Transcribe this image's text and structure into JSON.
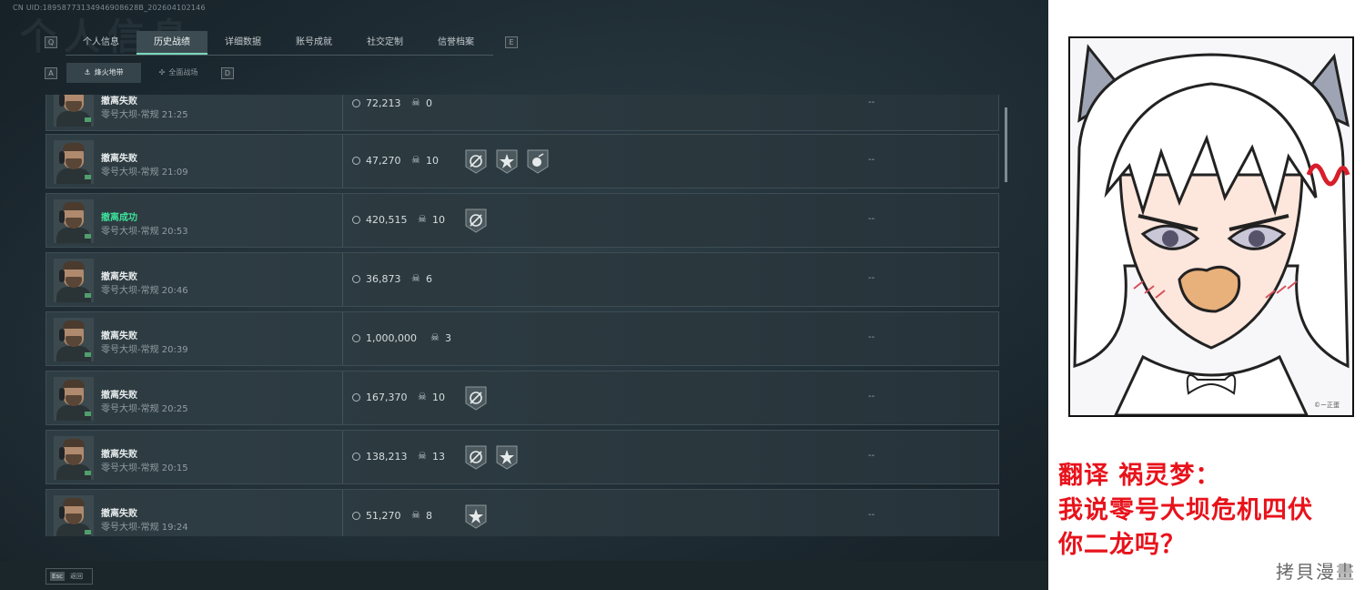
{
  "game": {
    "uid_text": "CN UID:18958773134946908628B_202604102146",
    "bg_title": "个人信息",
    "key_left": "Q",
    "key_right": "E",
    "sub_key_left": "A",
    "sub_key_right": "D",
    "tabs": [
      {
        "label": "个人信息",
        "active": false
      },
      {
        "label": "历史战绩",
        "active": true
      },
      {
        "label": "详细数据",
        "active": false
      },
      {
        "label": "账号成就",
        "active": false
      },
      {
        "label": "社交定制",
        "active": false
      },
      {
        "label": "信誉档案",
        "active": false
      }
    ],
    "subtabs": [
      {
        "label": "烽火地带",
        "icon": "lighthouse-icon",
        "active": true
      },
      {
        "label": "全面战场",
        "icon": "crosshair-icon",
        "active": false
      }
    ],
    "records": [
      {
        "status": "撤离失败",
        "success": false,
        "mode": "零号大坝-常规 21:25",
        "value": "72,213",
        "kills": "0",
        "badges": [],
        "extra": "--"
      },
      {
        "status": "撤离失败",
        "success": false,
        "mode": "零号大坝-常规 21:09",
        "value": "47,270",
        "kills": "10",
        "badges": [
          "wrench-badge",
          "star-badge",
          "grenade-badge"
        ],
        "extra": "--"
      },
      {
        "status": "撤离成功",
        "success": true,
        "mode": "零号大坝-常规 20:53",
        "value": "420,515",
        "kills": "10",
        "badges": [
          "wrench-badge"
        ],
        "extra": "--"
      },
      {
        "status": "撤离失败",
        "success": false,
        "mode": "零号大坝-常规 20:46",
        "value": "36,873",
        "kills": "6",
        "badges": [],
        "extra": "--"
      },
      {
        "status": "撤离失败",
        "success": false,
        "mode": "零号大坝-常规 20:39",
        "value": "1,000,000",
        "kills": "3",
        "badges": [],
        "extra": "--"
      },
      {
        "status": "撤离失败",
        "success": false,
        "mode": "零号大坝-常规 20:25",
        "value": "167,370",
        "kills": "10",
        "badges": [
          "wrench-badge"
        ],
        "extra": "--"
      },
      {
        "status": "撤离失败",
        "success": false,
        "mode": "零号大坝-常规 20:15",
        "value": "138,213",
        "kills": "13",
        "badges": [
          "wrench-badge",
          "star-badge"
        ],
        "extra": "--"
      },
      {
        "status": "撤离失败",
        "success": false,
        "mode": "零号大坝-常规 19:24",
        "value": "51,270",
        "kills": "8",
        "badges": [
          "star-badge"
        ],
        "extra": "--"
      }
    ],
    "esc_key": "Esc",
    "esc_label": "返回"
  },
  "meme": {
    "caption_line1": "翻译 祸灵梦：",
    "caption_line2": "我说零号大坝危机四伏",
    "caption_line3": "你二龙吗？",
    "signature": "©ー正蛋",
    "watermark": "拷貝漫畫"
  },
  "colors": {
    "success": "#3ee09a",
    "tab_active_underline": "#7bd7ba",
    "caption_red": "#e8121b"
  }
}
